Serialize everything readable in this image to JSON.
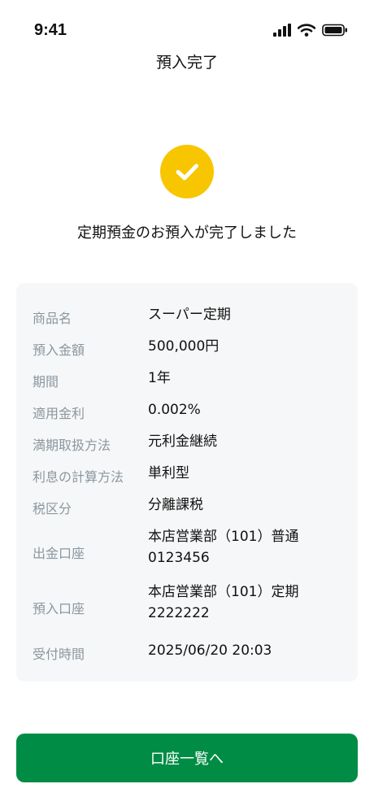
{
  "status_bar": {
    "time": "9:41",
    "icons": [
      "signal-icon",
      "wifi-icon",
      "battery-icon"
    ]
  },
  "header": {
    "title": "預入完了"
  },
  "success": {
    "icon": "checkmark-icon",
    "icon_color": "#f7c600",
    "message": "定期預金のお預入が完了しました"
  },
  "details": [
    {
      "label": "商品名",
      "value": "スーパー定期"
    },
    {
      "label": "預入金額",
      "value": "500,000円"
    },
    {
      "label": "期間",
      "value": "1年"
    },
    {
      "label": "適用金利",
      "value": "0.002%"
    },
    {
      "label": "満期取扱方法",
      "value": "元利金継続"
    },
    {
      "label": "利息の計算方法",
      "value": "単利型"
    },
    {
      "label": "税区分",
      "value": "分離課税"
    },
    {
      "label": "出金口座",
      "value": "本店営業部（101）普通\n0123456"
    },
    {
      "label": "預入口座",
      "value": "本店営業部（101）定期\n2222222"
    },
    {
      "label": "受付時間",
      "value": "2025/06/20 20:03"
    }
  ],
  "footer": {
    "button_label": "口座一覧へ",
    "button_color": "#008c45"
  }
}
